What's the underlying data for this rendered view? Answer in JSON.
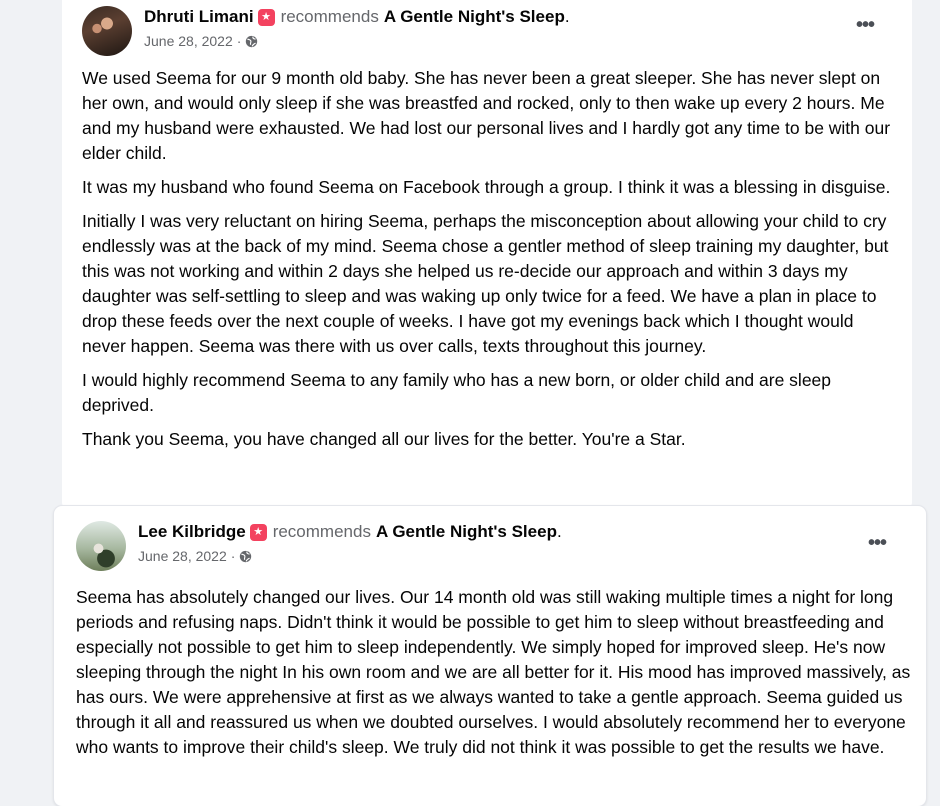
{
  "posts": [
    {
      "author": "Dhruti Limani",
      "recommends_text": "recommends",
      "page_name": "A Gentle Night's Sleep",
      "date": "June 28, 2022",
      "separator": "·",
      "more_label": "•••",
      "paragraphs": [
        "We used Seema for our 9 month old baby. She has never been a great sleeper. She has never slept on her own, and would only sleep if she was breastfed and rocked, only to then wake up every 2 hours. Me and my husband were exhausted. We had lost our personal lives and I hardly got any time to be with our elder child.",
        "It was my husband who found Seema on Facebook through a group. I think it was a blessing in disguise.",
        "Initially I was very reluctant on hiring Seema, perhaps the misconception about allowing your child to cry endlessly was at the back of my mind. Seema chose a gentler method of sleep training my daughter, but this was not working and within 2 days she helped us re-decide our approach and within 3 days my daughter was self-settling to sleep and was waking up only twice for a feed. We have a plan in place to drop these feeds over the next couple of weeks. I have got my evenings back which I thought would never happen. Seema was there with us over calls, texts throughout this journey.",
        "I would highly recommend Seema to any family who has a new born, or older child and are sleep deprived.",
        "Thank you Seema, you have changed all our lives for the better. You're a Star."
      ]
    },
    {
      "author": "Lee Kilbridge",
      "recommends_text": "recommends",
      "page_name": "A Gentle Night's Sleep",
      "date": "June 28, 2022",
      "separator": "·",
      "more_label": "•••",
      "paragraphs": [
        "Seema has absolutely changed our lives. Our 14 month old was still waking multiple times a night for long periods and refusing naps. Didn't think it would be possible to get him to sleep without breastfeeding and especially not possible to get him to sleep independently. We simply hoped for improved sleep. He's now sleeping through the night In his own room and we are all better for it. His mood has improved massively, as has ours. We were apprehensive at first as we always wanted to take a gentle approach. Seema guided us through it all and reassured us when we doubted ourselves. I would absolutely recommend her to everyone who wants to improve their child's sleep. We truly did not think it was possible to get the results we have."
      ]
    }
  ],
  "icons": {
    "badge": "recommendation-star-icon",
    "privacy": "globe-icon",
    "more": "more-options-icon"
  },
  "colors": {
    "background": "#f0f2f5",
    "card": "#ffffff",
    "badge": "#f3425f",
    "secondary_text": "#65676b"
  }
}
